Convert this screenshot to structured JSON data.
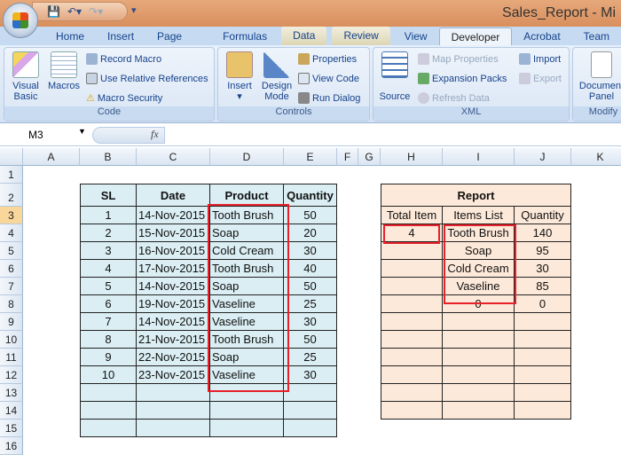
{
  "window": {
    "title": "Sales_Report - Mi"
  },
  "ribbon_tabs": [
    "Home",
    "Insert",
    "Page Layout",
    "Formulas",
    "Data",
    "Review",
    "View",
    "Developer",
    "Acrobat",
    "Team"
  ],
  "active_tab": "Developer",
  "groups": {
    "code": {
      "label": "Code",
      "visual_basic": "Visual Basic",
      "macros": "Macros",
      "record_macro": "Record Macro",
      "relative_refs": "Use Relative References",
      "macro_security": "Macro Security"
    },
    "controls": {
      "label": "Controls",
      "insert": "Insert",
      "design_mode": "Design Mode",
      "properties": "Properties",
      "view_code": "View Code",
      "run_dialog": "Run Dialog"
    },
    "xml": {
      "label": "XML",
      "source": "Source",
      "map_properties": "Map Properties",
      "expansion_packs": "Expansion Packs",
      "refresh_data": "Refresh Data",
      "import": "Import",
      "export": "Export"
    },
    "modify": {
      "label": "Modify",
      "document_panel": "Document Panel"
    }
  },
  "formula_bar": {
    "name_box": "M3",
    "fx": "fx",
    "formula": ""
  },
  "columns": [
    "A",
    "B",
    "C",
    "D",
    "E",
    "F",
    "G",
    "H",
    "I",
    "J",
    "K"
  ],
  "rows": [
    "1",
    "2",
    "3",
    "4",
    "5",
    "6",
    "7",
    "8",
    "9",
    "10",
    "11",
    "12",
    "13",
    "14",
    "15",
    "16"
  ],
  "sales_table": {
    "headers": [
      "SL",
      "Date",
      "Product",
      "Quantity"
    ],
    "rows": [
      [
        "1",
        "14-Nov-2015",
        "Tooth Brush",
        "50"
      ],
      [
        "2",
        "15-Nov-2015",
        "Soap",
        "20"
      ],
      [
        "3",
        "16-Nov-2015",
        "Cold Cream",
        "30"
      ],
      [
        "4",
        "17-Nov-2015",
        "Tooth Brush",
        "40"
      ],
      [
        "5",
        "14-Nov-2015",
        "Soap",
        "50"
      ],
      [
        "6",
        "19-Nov-2015",
        "Vaseline",
        "25"
      ],
      [
        "7",
        "14-Nov-2015",
        "Vaseline",
        "30"
      ],
      [
        "8",
        "21-Nov-2015",
        "Tooth Brush",
        "50"
      ],
      [
        "9",
        "22-Nov-2015",
        "Soap",
        "25"
      ],
      [
        "10",
        "23-Nov-2015",
        "Vaseline",
        "30"
      ]
    ]
  },
  "report": {
    "title": "Report",
    "headers": [
      "Total Item",
      "Items List",
      "Quantity"
    ],
    "total_item": "4",
    "rows": [
      [
        "Tooth Brush",
        "140"
      ],
      [
        "Soap",
        "95"
      ],
      [
        "Cold Cream",
        "30"
      ],
      [
        "Vaseline",
        "85"
      ],
      [
        "0",
        "0"
      ]
    ]
  }
}
